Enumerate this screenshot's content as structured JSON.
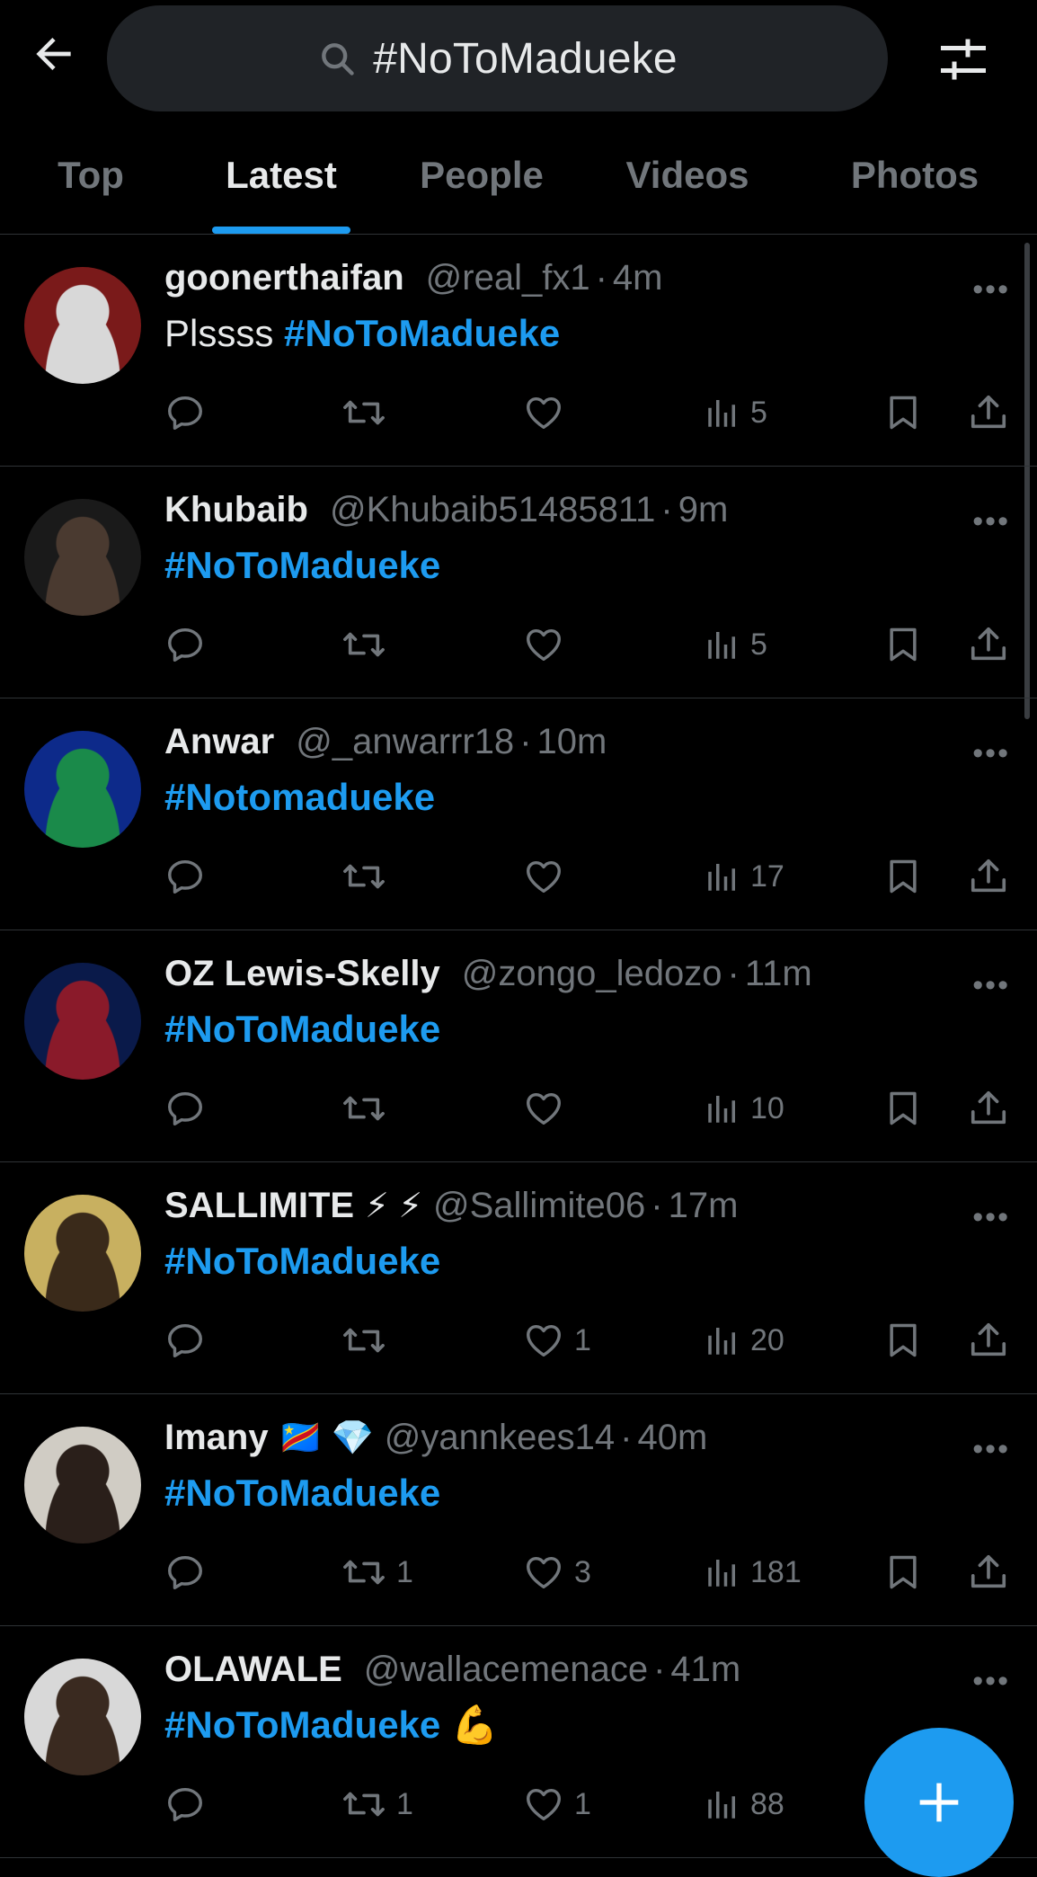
{
  "search": {
    "query": "#NoToMadueke",
    "icons": {
      "back": "arrow-left-icon",
      "search": "search-icon",
      "filter": "sliders-icon"
    }
  },
  "tabs": [
    {
      "label": "Top",
      "active": false
    },
    {
      "label": "Latest",
      "active": true
    },
    {
      "label": "People",
      "active": false
    },
    {
      "label": "Videos",
      "active": false
    },
    {
      "label": "Photos",
      "active": false
    }
  ],
  "tweets": [
    {
      "name": "goonerthaifan",
      "name_emoji": "",
      "handle": "@real_fx1",
      "time": "4m",
      "text_prefix": "Plssss ",
      "hashtag": "#NoToMadueke",
      "text_suffix": "",
      "replies": "",
      "retweets": "",
      "likes": "",
      "views": "5",
      "avatar_colors": [
        "#7a1a1a",
        "#d8d8d8"
      ]
    },
    {
      "name": "Khubaib",
      "name_emoji": "",
      "handle": "@Khubaib51485811",
      "time": "9m",
      "text_prefix": "",
      "hashtag": "#NoToMadueke",
      "text_suffix": "",
      "replies": "",
      "retweets": "",
      "likes": "",
      "views": "5",
      "avatar_colors": [
        "#1a1a1a",
        "#4a3a30"
      ]
    },
    {
      "name": "Anwar",
      "name_emoji": "",
      "handle": "@_anwarrr18",
      "time": "10m",
      "text_prefix": "",
      "hashtag": "#Notomadueke",
      "text_suffix": "",
      "replies": "",
      "retweets": "",
      "likes": "",
      "views": "17",
      "avatar_colors": [
        "#0d2a8a",
        "#1a8a4a"
      ]
    },
    {
      "name": "OZ Lewis-Skelly",
      "name_emoji": "",
      "handle": "@zongo_ledozo",
      "time": "11m",
      "text_prefix": "",
      "hashtag": "#NoToMadueke",
      "text_suffix": "",
      "replies": "",
      "retweets": "",
      "likes": "",
      "views": "10",
      "avatar_colors": [
        "#0a1a4a",
        "#8a1a2a"
      ]
    },
    {
      "name": "SALLIMITE",
      "name_emoji": "⚡ ⚡",
      "handle": "@Sallimite06",
      "time": "17m",
      "text_prefix": "",
      "hashtag": "#NoToMadueke",
      "text_suffix": "",
      "replies": "",
      "retweets": "",
      "likes": "1",
      "views": "20",
      "avatar_colors": [
        "#c8b060",
        "#3a2a1a"
      ]
    },
    {
      "name": "Imany",
      "name_emoji": "🇨🇩 💎",
      "handle": "@yannkees14",
      "time": "40m",
      "text_prefix": "",
      "hashtag": "#NoToMadueke",
      "text_suffix": "",
      "replies": "",
      "retweets": "1",
      "likes": "3",
      "views": "181",
      "avatar_colors": [
        "#d0ccc4",
        "#2a1f1a"
      ]
    },
    {
      "name": "OLAWALE",
      "name_emoji": "",
      "handle": "@wallacemenace",
      "time": "41m",
      "text_prefix": "",
      "hashtag": "#NoToMadueke",
      "text_suffix": " 💪",
      "replies": "",
      "retweets": "1",
      "likes": "1",
      "views": "88",
      "avatar_colors": [
        "#d8d8d8",
        "#3a2a20"
      ]
    }
  ],
  "compose": {
    "icon": "plus-icon"
  },
  "colors": {
    "accent": "#1d9bf0",
    "muted": "#71767b",
    "text": "#e7e9ea",
    "background": "#000000"
  }
}
